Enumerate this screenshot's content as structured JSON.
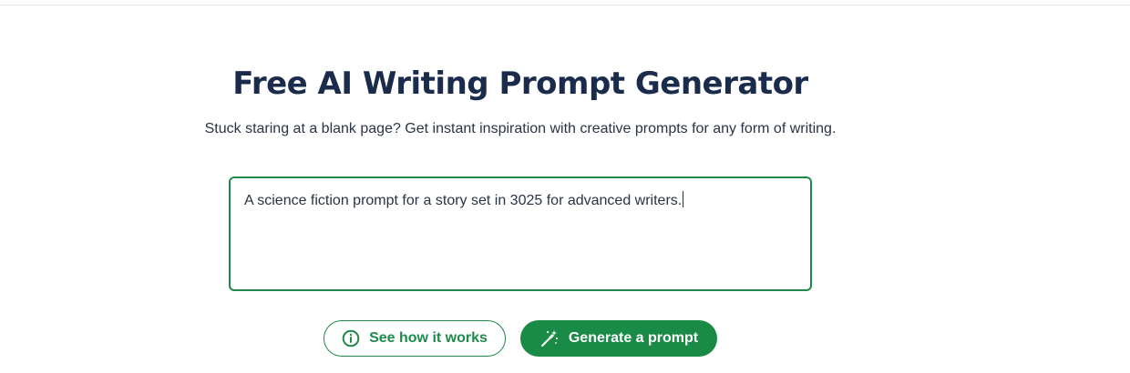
{
  "hero": {
    "title": "Free AI Writing Prompt Generator",
    "subtitle": "Stuck staring at a blank page? Get instant inspiration with creative prompts for any form of writing."
  },
  "prompt_input": {
    "value": "A science fiction prompt for a story set in 3025 for advanced writers."
  },
  "actions": {
    "how_it_works_label": "See how it works",
    "how_it_works_icon": "info-circle-icon",
    "generate_label": "Generate a prompt",
    "generate_icon": "magic-wand-icon"
  },
  "colors": {
    "accent": "#1f8a4c",
    "title": "#1a2b4c",
    "text": "#2b3444"
  }
}
